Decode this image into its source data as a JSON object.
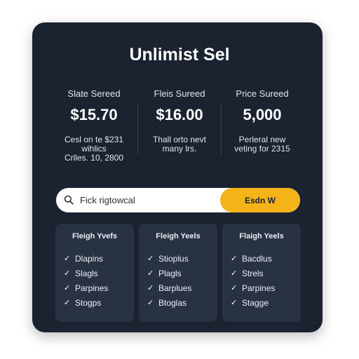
{
  "title": "Unlimist Sel",
  "columns": [
    {
      "label": "Slate Sereed",
      "price": "$15.70",
      "desc": [
        "Cesl on te $231",
        "wihlics",
        "Crlles. 10, 2800"
      ]
    },
    {
      "label": "Fleis Sureed",
      "price": "$16.00",
      "desc": [
        "Thall orto nevt",
        "many lrs."
      ]
    },
    {
      "label": "Price Sureed",
      "price": "5,000",
      "desc": [
        "Perleral new",
        "veting for 2315"
      ]
    }
  ],
  "search": {
    "placeholder": "Fick rigtowcal",
    "button_label": "Esdn W"
  },
  "panels": [
    {
      "heading": "Fleigh Yvefs",
      "items": [
        "Dlapins",
        "Slagls",
        "Parpines",
        "Stogps"
      ]
    },
    {
      "heading": "Fleigh Yeels",
      "items": [
        "Stioplus",
        "Plagls",
        "Barplues",
        "Btoglas"
      ]
    },
    {
      "heading": "Flaigh Yeels",
      "items": [
        "Bacdlus",
        "Strels",
        "Parpines",
        "Stagge"
      ]
    }
  ],
  "icons": {
    "search": "search-icon",
    "check": "checkmark-icon"
  },
  "colors": {
    "card": "#1b2230",
    "panel": "#283243",
    "accent": "#f5b31a"
  }
}
